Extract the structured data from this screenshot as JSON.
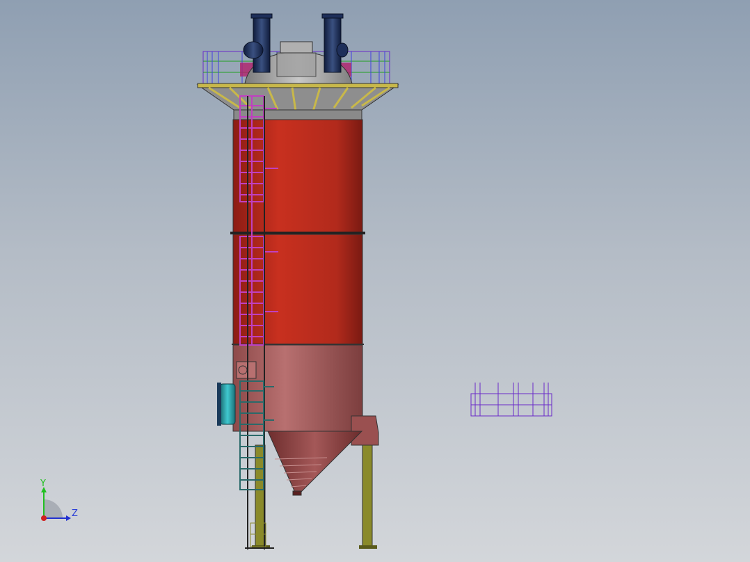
{
  "viewport": {
    "background_top": "#8f9fb2",
    "background_bottom": "#d3d6da"
  },
  "model": {
    "shell_color": "#b5281e",
    "lower_shell_color": "#a45a5a",
    "ladder_color": "#c040c0",
    "ladder_lower_color": "#2a6a6a",
    "platform_color": "#c8b84a",
    "pipe_color": "#1e2f5a",
    "leg_color": "#8a8a2a",
    "inlet_color": "#2aa8b0",
    "railing_color": "#6a2ac8"
  },
  "triad": {
    "y_label": "Y",
    "z_label": "Z",
    "y_color": "#20c020",
    "z_color": "#2030d0",
    "x_color": "#d02020"
  }
}
